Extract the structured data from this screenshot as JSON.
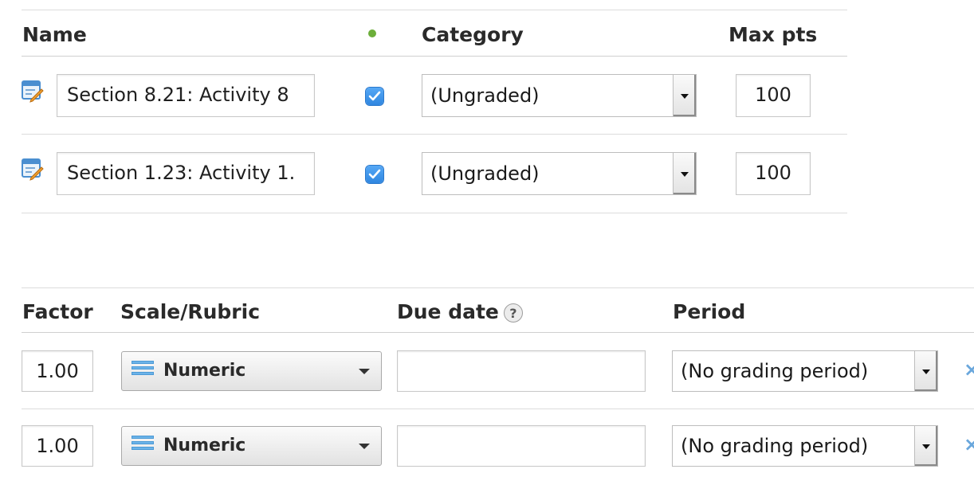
{
  "top_table": {
    "headers": {
      "name": "Name",
      "category": "Category",
      "max_pts": "Max pts"
    },
    "rows": [
      {
        "name": "Section  8.21: Activity 8",
        "checked": true,
        "category": "(Ungraded)",
        "max_pts": "100"
      },
      {
        "name": "Section 1.23: Activity 1.",
        "checked": true,
        "category": "(Ungraded)",
        "max_pts": "100"
      }
    ]
  },
  "bottom_table": {
    "headers": {
      "factor": "Factor",
      "scale": "Scale/Rubric",
      "due_date": "Due date",
      "due_help": "?",
      "period": "Period"
    },
    "rows": [
      {
        "factor": "1.00",
        "scale": "Numeric",
        "due_date": "",
        "period": "(No grading period)",
        "remove": "×"
      },
      {
        "factor": "1.00",
        "scale": "Numeric",
        "due_date": "",
        "period": "(No grading period)",
        "remove": "×"
      }
    ]
  },
  "colors": {
    "accent_blue": "#2f86e0",
    "status_dot": "#6cae3a"
  }
}
